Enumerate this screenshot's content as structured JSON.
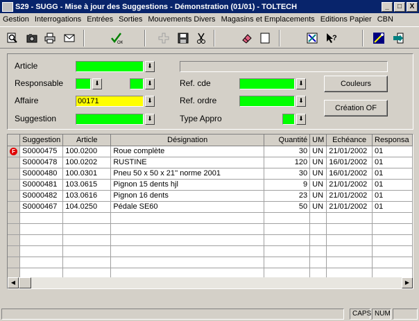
{
  "window": {
    "title": "S29 - SUGG - Mise à jour des Suggestions - Démonstration (01/01) - TOLTECH",
    "minimize": "_",
    "maximize": "□",
    "close": "X"
  },
  "menu": [
    "Gestion",
    "Interrogations",
    "Entrées",
    "Sorties",
    "Mouvements Divers",
    "Magasins et Emplacements",
    "Editions Papier",
    "CBN"
  ],
  "toolbar": {
    "icons": [
      "search-icon",
      "camera-icon",
      "printer-icon",
      "mail-icon",
      "ok-icon",
      "add-icon",
      "save-icon",
      "cut-icon",
      "eraser-icon",
      "new-page-icon",
      "tools-icon",
      "help-icon",
      "wizard-icon",
      "exit-icon"
    ],
    "ok_label": "OK"
  },
  "form": {
    "article_label": "Article",
    "responsable_label": "Responsable",
    "affaire_label": "Affaire",
    "affaire_value": "00171",
    "suggestion_label": "Suggestion",
    "ref_cde_label": "Ref. cde",
    "ref_ordre_label": "Ref. ordre",
    "type_appro_label": "Type Appro",
    "couleurs_button": "Couleurs",
    "creation_of_button": "Création OF"
  },
  "grid": {
    "columns": [
      "Suggestion",
      "Article",
      "Désignation",
      "Quantité",
      "UM",
      "Echéance",
      "Responsa"
    ],
    "rows": [
      {
        "suggestion": "S0000475",
        "article": "100.0200",
        "designation": "Roue complète",
        "quantite": "30",
        "um": "UN",
        "echeance": "21/01/2002",
        "responsable": "01",
        "flag": "F"
      },
      {
        "suggestion": "S0000478",
        "article": "100.0202",
        "designation": "RUSTINE",
        "quantite": "120",
        "um": "UN",
        "echeance": "16/01/2002",
        "responsable": "01",
        "flag": ""
      },
      {
        "suggestion": "S0000480",
        "article": "100.0301",
        "designation": "Pneu 50 x 50 x 21'' norme 2001",
        "quantite": "30",
        "um": "UN",
        "echeance": "16/01/2002",
        "responsable": "01",
        "flag": ""
      },
      {
        "suggestion": "S0000481",
        "article": "103.0615",
        "designation": "Pignon 15 dents hjl",
        "quantite": "9",
        "um": "UN",
        "echeance": "21/01/2002",
        "responsable": "01",
        "flag": ""
      },
      {
        "suggestion": "S0000482",
        "article": "103.0616",
        "designation": "Pignon 16 dents",
        "quantite": "23",
        "um": "UN",
        "echeance": "21/01/2002",
        "responsable": "01",
        "flag": ""
      },
      {
        "suggestion": "S0000467",
        "article": "104.0250",
        "designation": "Pédale SE60",
        "quantite": "50",
        "um": "UN",
        "echeance": "21/01/2002",
        "responsable": "01",
        "flag": ""
      }
    ],
    "empty_rows": 11
  },
  "status": {
    "caps": "CAPS",
    "num": "NUM"
  },
  "colors": {
    "title_bg": "#08246b",
    "field_green": "#00ff00",
    "field_yellow": "#ffff00",
    "flag_red": "#e00000"
  }
}
